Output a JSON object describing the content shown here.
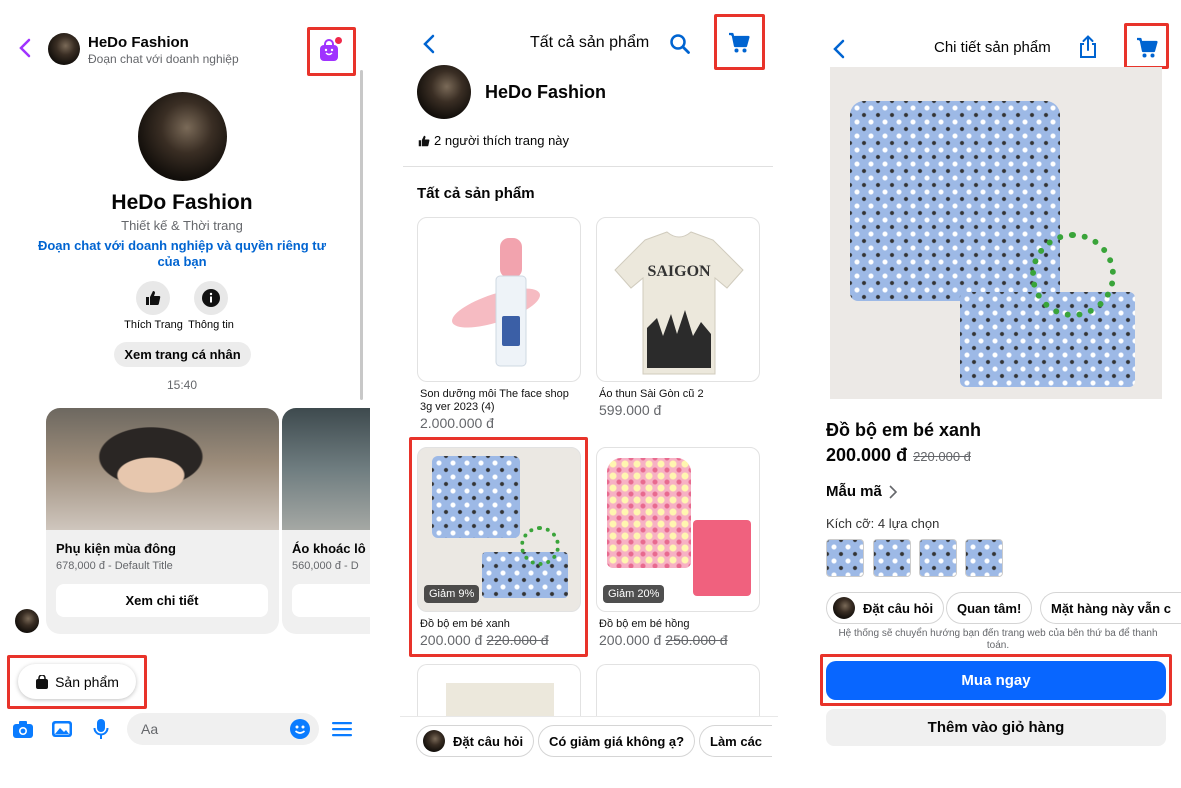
{
  "colors": {
    "accent": "#0064d1",
    "messenger_purple": "#a033ff",
    "highlight": "#e8332a",
    "buy_button": "#0866ff"
  },
  "chat": {
    "business_name": "HeDo Fashion",
    "subtitle": "Đoạn chat với doanh nghiệp",
    "profile_name": "HeDo Fashion",
    "category": "Thiết kế & Thời trang",
    "privacy_link": "Đoạn chat với doanh nghiệp và quyền riêng tư của bạn",
    "like_label": "Thích Trang",
    "info_label": "Thông tin",
    "view_profile": "Xem trang cá nhân",
    "time": "15:40",
    "cards": [
      {
        "title": "Phụ kiện mùa đông",
        "subtitle": "678,000 đ - Default Title",
        "button": "Xem chi tiết"
      },
      {
        "title": "Áo khoác lô",
        "subtitle": "560,000 đ - D",
        "button": "X"
      }
    ],
    "products_button": "Sản phẩm",
    "input_placeholder": "Aa"
  },
  "catalog": {
    "title": "Tất cả sản phẩm",
    "shop_name": "HeDo Fashion",
    "likes": "2 người thích trang này",
    "section_title": "Tất cả sản phẩm",
    "products": [
      {
        "name": "Son dưỡng môi The face shop 3g ver 2023 (4)",
        "price": "2.000.000 đ",
        "old_price": "",
        "badge": ""
      },
      {
        "name": "Áo thun Sài Gòn cũ 2",
        "price": "599.000 đ",
        "old_price": "",
        "badge": ""
      },
      {
        "name": "Đồ bộ em bé xanh",
        "price": "200.000 đ",
        "old_price": "220.000 đ",
        "badge": "Giảm 9%"
      },
      {
        "name": "Đồ bộ em bé hồng",
        "price": "200.000 đ",
        "old_price": "250.000 đ",
        "badge": "Giảm 20%"
      }
    ],
    "shirt_print": "SAIGON",
    "chips": [
      "Đặt câu hỏi",
      "Có giảm giá không ạ?",
      "Làm các"
    ]
  },
  "detail": {
    "title": "Chi tiết sản phẩm",
    "product_name": "Đồ bộ em bé xanh",
    "price": "200.000 đ",
    "old_price": "220.000 đ",
    "variants_label": "Mẫu mã",
    "size_label": "Kích cỡ: 4 lựa chọn",
    "chips": [
      "Đặt câu hỏi",
      "Quan tâm!",
      "Mặt hàng này vẫn c"
    ],
    "redirect_note": "Hệ thống sẽ chuyển hướng bạn đến trang web của bên thứ ba để thanh toán.",
    "buy_now": "Mua ngay",
    "add_to_cart": "Thêm vào giỏ hàng"
  }
}
